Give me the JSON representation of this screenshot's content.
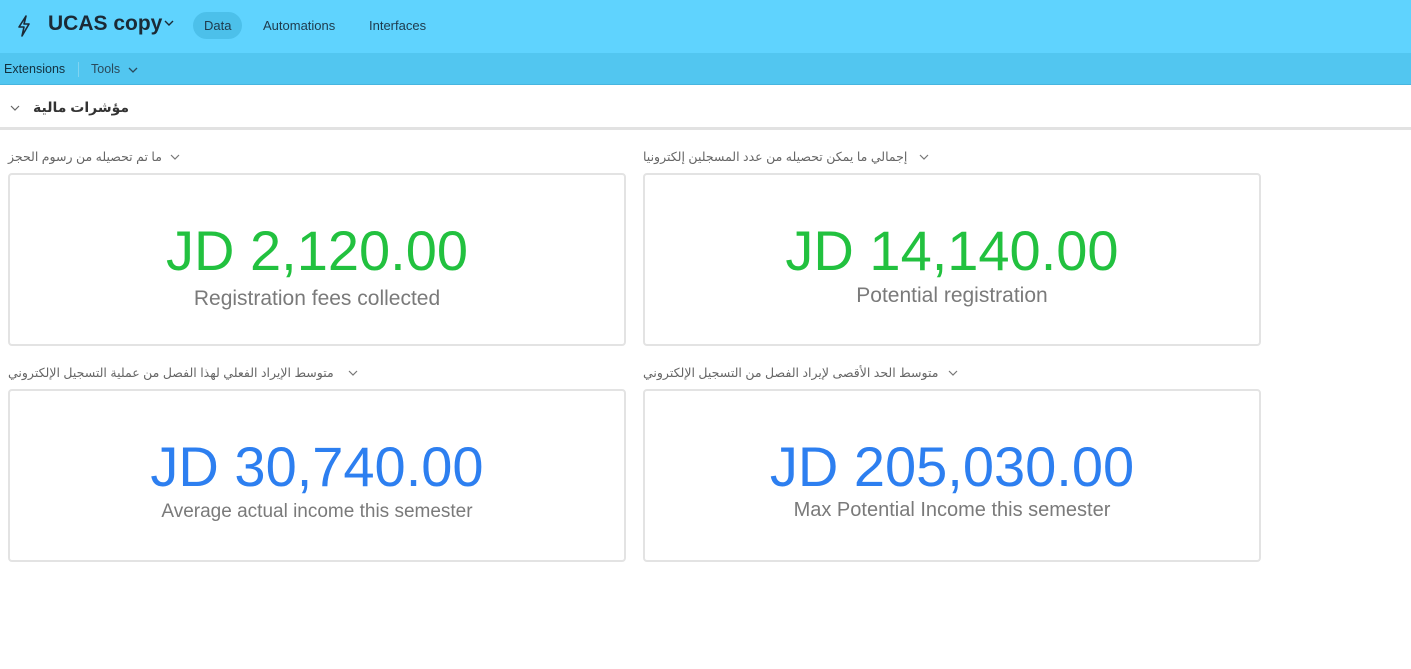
{
  "app": {
    "base_name": "UCAS copy",
    "icons": {
      "logo": "bolt-icon",
      "base_menu": "chevron-down-icon"
    },
    "tabs": [
      {
        "label": "Data",
        "active": true
      },
      {
        "label": "Automations",
        "active": false
      },
      {
        "label": "Interfaces",
        "active": false
      }
    ]
  },
  "toolbar": {
    "extensions_label": "Extensions",
    "tools_label": "Tools"
  },
  "section": {
    "title": "مؤشرات مالية"
  },
  "cards": [
    {
      "label": "ما تم تحصيله من رسوم الحجز",
      "value": "JD 2,120.00",
      "description": "Registration fees collected",
      "color": "#22c13f"
    },
    {
      "label": "إجمالي ما يمكن تحصيله من عدد المسجلين إلكترونيا",
      "value": "JD 14,140.00",
      "description": "Potential registration",
      "color": "#22c13f"
    },
    {
      "label": "متوسط الإيراد الفعلي لهذا الفصل من عملية التسجيل الإلكتروني",
      "value": "JD 30,740.00",
      "description": "Average actual income this semester",
      "color": "#2d7ff0"
    },
    {
      "label": "متوسط الحد الأقصى لإيراد الفصل من التسجيل الإلكتروني",
      "value": "JD 205,030.00",
      "description": "Max Potential Income this semester",
      "color": "#2d7ff0"
    }
  ]
}
